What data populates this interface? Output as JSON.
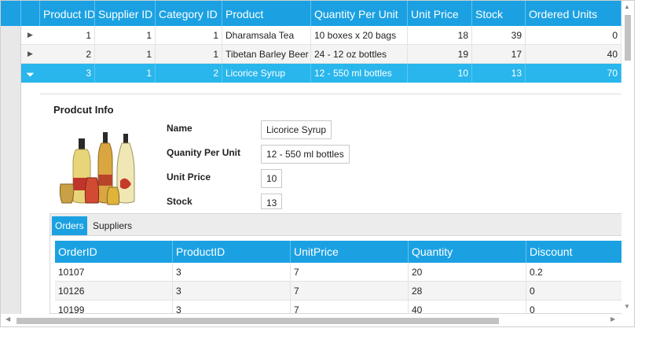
{
  "columns": [
    "Product ID",
    "Supplier ID",
    "Category ID",
    "Product",
    "Quantity Per Unit",
    "Unit Price",
    "Stock",
    "Ordered Units"
  ],
  "rows": [
    {
      "product_id": "1",
      "supplier_id": "1",
      "category_id": "1",
      "product": "Dharamsala Tea",
      "qpu": "10 boxes x 20 bags",
      "unit_price": "18",
      "stock": "39",
      "ordered": "0"
    },
    {
      "product_id": "2",
      "supplier_id": "1",
      "category_id": "1",
      "product": "Tibetan Barley Beer",
      "qpu": "24 - 12 oz bottles",
      "unit_price": "19",
      "stock": "17",
      "ordered": "40"
    },
    {
      "product_id": "3",
      "supplier_id": "1",
      "category_id": "2",
      "product": "Licorice Syrup",
      "qpu": "12 - 550 ml bottles",
      "unit_price": "10",
      "stock": "13",
      "ordered": "70"
    }
  ],
  "detail": {
    "title": "Prodcut Info",
    "fields": [
      {
        "label": "Name",
        "value": "Licorice Syrup"
      },
      {
        "label": "Quanity Per Unit",
        "value": "12 - 550 ml bottles"
      },
      {
        "label": "Unit Price",
        "value": "10"
      },
      {
        "label": "Stock",
        "value": "13"
      }
    ],
    "tabs": [
      "Orders",
      "Suppliers"
    ],
    "active_tab": "Orders",
    "orders_columns": [
      "OrderID",
      "ProductID",
      "UnitPrice",
      "Quantity",
      "Discount"
    ],
    "orders_rows": [
      [
        "10107",
        "3",
        "7",
        "20",
        "0.2"
      ],
      [
        "10126",
        "3",
        "7",
        "28",
        "0"
      ],
      [
        "10199",
        "3",
        "7",
        "40",
        "0"
      ]
    ]
  },
  "colors": {
    "accent": "#1ba1e2",
    "selected_row": "#29b6ec"
  },
  "icons": {
    "expand": "triangle-right-icon",
    "collapse": "triangle-down-icon"
  }
}
